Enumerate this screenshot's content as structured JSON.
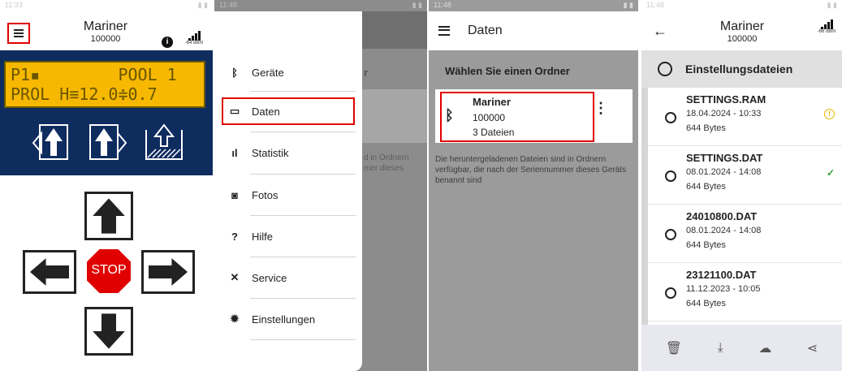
{
  "panel1": {
    "status_time": "11:33",
    "device_title": "Mariner",
    "device_id": "100000",
    "signal_text": "-64 dBm",
    "lcd_line1": "P1▪        POOL 1",
    "lcd_line2": "PROL H≡12.0≑0.7",
    "stop_label": "STOP"
  },
  "panel2": {
    "status_time": "11:48",
    "menu": [
      {
        "label": "Geräte",
        "icon": "bluetooth-icon"
      },
      {
        "label": "Daten",
        "icon": "folder-icon"
      },
      {
        "label": "Statistik",
        "icon": "chart-icon"
      },
      {
        "label": "Fotos",
        "icon": "camera-icon"
      },
      {
        "label": "Hilfe",
        "icon": "help-icon"
      },
      {
        "label": "Service",
        "icon": "tools-icon"
      },
      {
        "label": "Einstellungen",
        "icon": "gear-icon"
      }
    ],
    "ghost_line1": "d in Ordnern",
    "ghost_line2": "mer dieses"
  },
  "panel3": {
    "status_time": "11:48",
    "title": "Daten",
    "subtitle": "Wählen Sie einen Ordner",
    "folder_name": "Mariner",
    "folder_id": "100000",
    "folder_count": "3 Dateien",
    "description": "Die heruntergeladenen Dateien sind in Ordnern verfügbar, die nach der Seriennummer dieses Geräts benannt sind"
  },
  "panel4": {
    "status_time": "11:48",
    "device_title": "Mariner",
    "device_id": "100000",
    "signal_text": "-66 dBm",
    "list_header": "Einstellungsdateien",
    "files": [
      {
        "name": "SETTINGS.RAM",
        "date": "18.04.2024 - 10:33",
        "size": "644 Bytes",
        "status": "warning"
      },
      {
        "name": "SETTINGS.DAT",
        "date": "08.01.2024 - 14:08",
        "size": "644 Bytes",
        "status": "check"
      },
      {
        "name": "24010800.DAT",
        "date": "08.01.2024 - 14:08",
        "size": "644 Bytes",
        "status": ""
      },
      {
        "name": "23121100.DAT",
        "date": "11.12.2023 - 10:05",
        "size": "644 Bytes",
        "status": ""
      }
    ]
  }
}
